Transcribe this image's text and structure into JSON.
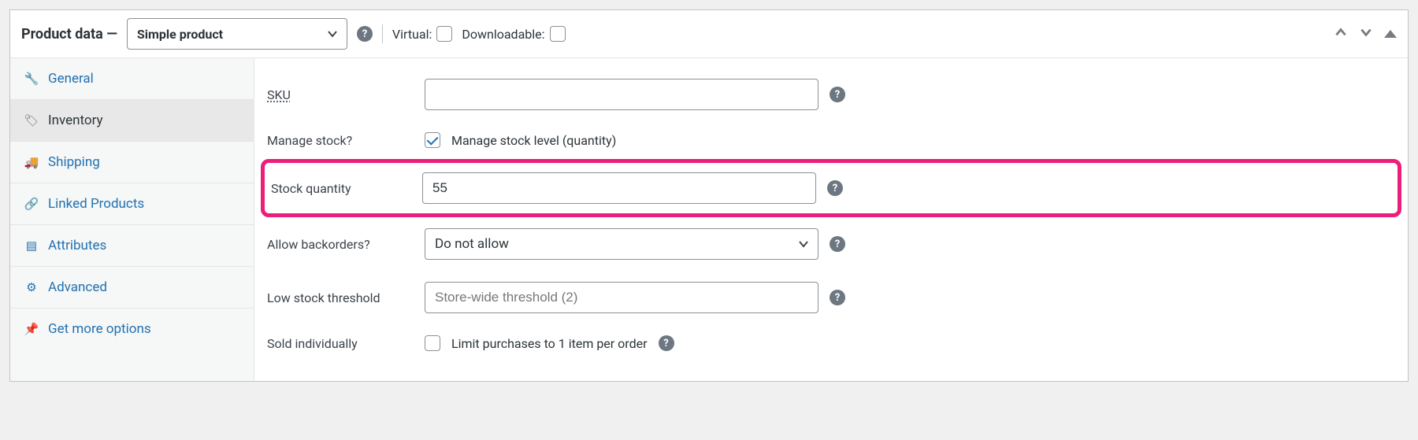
{
  "header": {
    "title": "Product data —",
    "product_type_selected": "Simple product",
    "virtual_label": "Virtual:",
    "downloadable_label": "Downloadable:",
    "virtual_checked": false,
    "downloadable_checked": false
  },
  "tabs": [
    {
      "id": "general",
      "label": "General",
      "icon": "wrench"
    },
    {
      "id": "inventory",
      "label": "Inventory",
      "icon": "tag",
      "active": true
    },
    {
      "id": "shipping",
      "label": "Shipping",
      "icon": "truck"
    },
    {
      "id": "linked",
      "label": "Linked Products",
      "icon": "link"
    },
    {
      "id": "attributes",
      "label": "Attributes",
      "icon": "list"
    },
    {
      "id": "advanced",
      "label": "Advanced",
      "icon": "gear"
    },
    {
      "id": "getmore",
      "label": "Get more options",
      "icon": "pin"
    }
  ],
  "form": {
    "sku": {
      "label": "SKU",
      "value": ""
    },
    "manage_stock": {
      "label": "Manage stock?",
      "checkbox_label": "Manage stock level (quantity)",
      "checked": true
    },
    "stock_quantity": {
      "label": "Stock quantity",
      "value": "55"
    },
    "allow_backorders": {
      "label": "Allow backorders?",
      "selected": "Do not allow"
    },
    "low_stock": {
      "label": "Low stock threshold",
      "placeholder": "Store-wide threshold (2)",
      "value": ""
    },
    "sold_individually": {
      "label": "Sold individually",
      "checkbox_label": "Limit purchases to 1 item per order",
      "checked": false
    }
  }
}
